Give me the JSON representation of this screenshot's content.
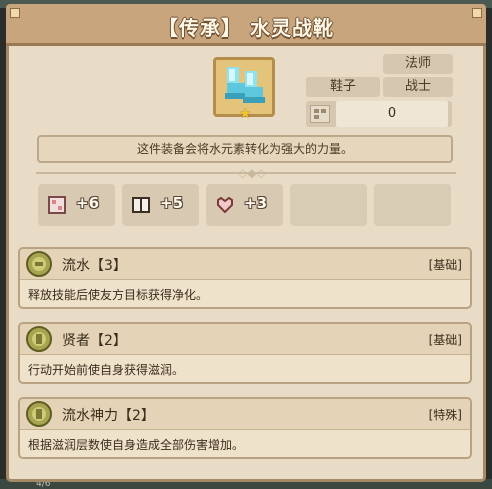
{
  "window": {
    "title": "【传承】 水灵战靴",
    "footer_text": "4/6"
  },
  "item": {
    "icon": "crystal-boots-icon",
    "rarity_mark": "star-icon",
    "slot_type": "鞋子",
    "classes": [
      "法师",
      "战士"
    ],
    "counter_value": "0",
    "description": "这件装备会将水元素转化为强大的力量。"
  },
  "stats": [
    {
      "icon": "attack-book-icon",
      "value": "+6"
    },
    {
      "icon": "spellbook-icon",
      "value": "+5"
    },
    {
      "icon": "heart-icon",
      "value": "+3"
    }
  ],
  "effects": [
    {
      "icon": "water-coin-icon",
      "title": "流水【3】",
      "type": "[基础]",
      "description": "释放技能后使友方目标获得净化。"
    },
    {
      "icon": "sage-coin-icon",
      "title": "贤者【2】",
      "type": "[基础]",
      "description": "行动开始前使自身获得滋润。"
    },
    {
      "icon": "sage-coin-icon",
      "title": "流水神力【2】",
      "type": "[特殊]",
      "description": "根据滋润层数使自身造成全部伤害增加。"
    }
  ],
  "colors": {
    "panel": "#e9dcc6",
    "title_bar": "#c8a57c",
    "accent_gold": "#e4c37a"
  }
}
